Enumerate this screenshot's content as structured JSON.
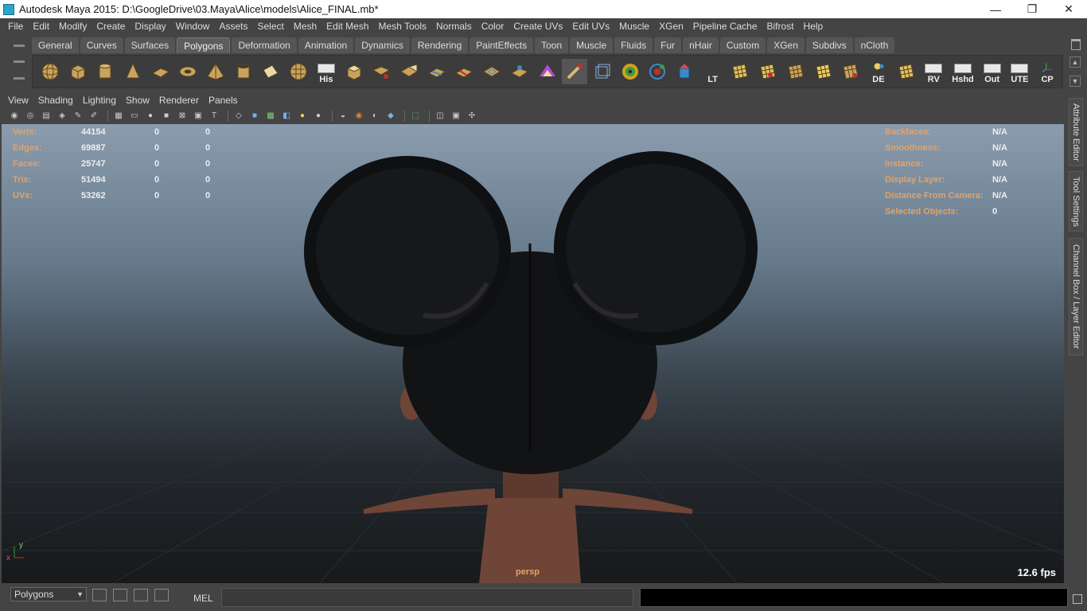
{
  "window": {
    "title": "Autodesk Maya 2015: D:\\GoogleDrive\\03.Maya\\Alice\\models\\Alice_FINAL.mb*",
    "minimize": "—",
    "restore": "❐",
    "close": "✕"
  },
  "menubar": [
    "File",
    "Edit",
    "Modify",
    "Create",
    "Display",
    "Window",
    "Assets",
    "Select",
    "Mesh",
    "Edit Mesh",
    "Mesh Tools",
    "Normals",
    "Color",
    "Create UVs",
    "Edit UVs",
    "Muscle",
    "XGen",
    "Pipeline Cache",
    "Bifrost",
    "Help"
  ],
  "shelf": {
    "tabs": [
      "General",
      "Curves",
      "Surfaces",
      "Polygons",
      "Deformation",
      "Animation",
      "Dynamics",
      "Rendering",
      "PaintEffects",
      "Toon",
      "Muscle",
      "Fluids",
      "Fur",
      "nHair",
      "Custom",
      "XGen",
      "Subdivs",
      "nCloth"
    ],
    "active_tab": "Polygons",
    "text_icons": {
      "his": "His",
      "lt": "LT",
      "de": "DE",
      "rv": "RV",
      "hshd": "Hshd",
      "out": "Out",
      "ute": "UTE",
      "cp": "CP"
    }
  },
  "panel_menu": [
    "View",
    "Shading",
    "Lighting",
    "Show",
    "Renderer",
    "Panels"
  ],
  "hud_left": [
    {
      "label": "Verts:",
      "v1": "44154",
      "v2": "0",
      "v3": "0"
    },
    {
      "label": "Edges:",
      "v1": "69887",
      "v2": "0",
      "v3": "0"
    },
    {
      "label": "Faces:",
      "v1": "25747",
      "v2": "0",
      "v3": "0"
    },
    {
      "label": "Tris:",
      "v1": "51494",
      "v2": "0",
      "v3": "0"
    },
    {
      "label": "UVs:",
      "v1": "53262",
      "v2": "0",
      "v3": "0"
    }
  ],
  "hud_right": [
    {
      "label": "Backfaces:",
      "value": "N/A"
    },
    {
      "label": "Smoothness:",
      "value": "N/A"
    },
    {
      "label": "Instance:",
      "value": "N/A"
    },
    {
      "label": "Display Layer:",
      "value": "N/A"
    },
    {
      "label": "Distance From Camera:",
      "value": "N/A"
    },
    {
      "label": "Selected Objects:",
      "value": "0"
    }
  ],
  "viewport": {
    "camera": "persp",
    "fps": "12.6 fps",
    "axis_x": "x",
    "axis_y": "y"
  },
  "side_tabs": [
    "Attribute Editor",
    "Tool Settings",
    "Channel Box / Layer Editor"
  ],
  "cmdline": {
    "mode": "Polygons",
    "mel_label": "MEL"
  },
  "colors": {
    "hud_label": "#e4a26a",
    "hair": "#111214",
    "skin": "#6e4536"
  }
}
